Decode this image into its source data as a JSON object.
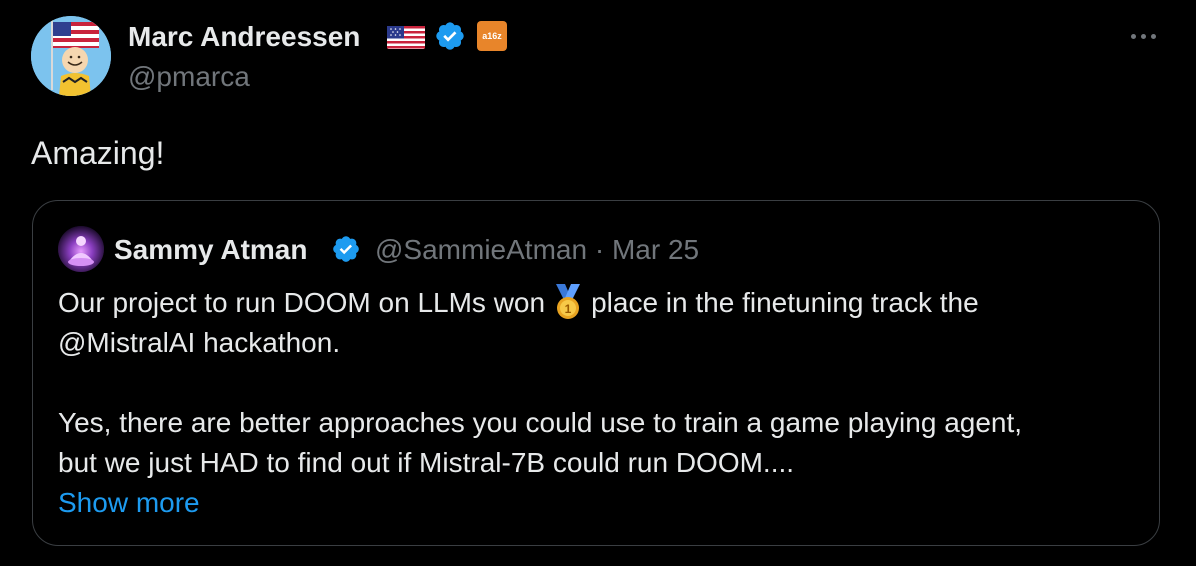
{
  "author": {
    "name": "Marc Andreessen",
    "handle": "@pmarca",
    "flag_icon": "us-flag-icon",
    "verified_icon": "verified-badge-icon",
    "affiliation_label": "a16z"
  },
  "tweet": {
    "text": "Amazing!"
  },
  "quoted": {
    "name": "Sammy Atman",
    "handle": "@SammieAtman",
    "separator": "·",
    "date": "Mar 25",
    "text_part1": "Our project to run DOOM on LLMs won",
    "medal_icon": "first-place-medal-icon",
    "text_part2": "place in the finetuning track the",
    "line2": "@MistralAI hackathon.",
    "line3": "Yes, there are better approaches you could use to train a game playing agent,",
    "line4": "but we just HAD to find out if Mistral-7B could run DOOM....",
    "show_more": "Show more"
  },
  "colors": {
    "background": "#000000",
    "text": "#e7e9ea",
    "secondary": "#71767b",
    "link": "#1d9bf0",
    "verified": "#1d9bf0",
    "border": "#3a3e42"
  }
}
